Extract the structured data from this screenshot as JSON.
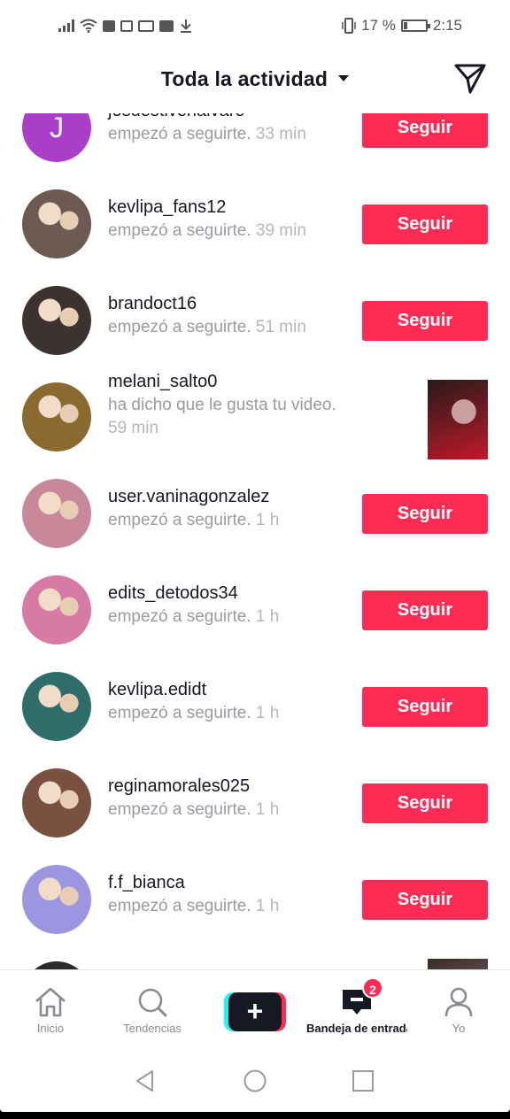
{
  "status_bar": {
    "battery_text": "17 %",
    "battery_level": 0.17,
    "time": "2:15"
  },
  "header": {
    "title": "Toda la actividad",
    "send_icon": "paper-plane-icon"
  },
  "items": [
    {
      "type": "follow",
      "username": "josuestivenalvare",
      "desc": "empezó a seguirte.",
      "time": "33 min",
      "button": "Seguir",
      "avatar_letter": "J",
      "avatar_color": "#a93fc8"
    },
    {
      "type": "follow",
      "username": "kevlipa_fans12",
      "desc": "empezó a seguirte.",
      "time": "39 min",
      "button": "Seguir",
      "avatar_color": "#6d5a52"
    },
    {
      "type": "follow",
      "username": "brandoct16",
      "desc": "empezó a seguirte.",
      "time": "51 min",
      "button": "Seguir",
      "avatar_color": "#3c3330"
    },
    {
      "type": "like",
      "username": "melani_salto0",
      "desc": "ha dicho que le gusta tu video.",
      "time": "59 min",
      "avatar_color": "#8a6a2e"
    },
    {
      "type": "follow",
      "username": "user.vaninagonzalez",
      "desc": "empezó a seguirte.",
      "time": "1 h",
      "button": "Seguir",
      "avatar_color": "#c9889a"
    },
    {
      "type": "follow",
      "username": "edits_detodos34",
      "desc": "empezó a seguirte.",
      "time": "1 h",
      "button": "Seguir",
      "avatar_color": "#d77aa6"
    },
    {
      "type": "follow",
      "username": "kevlipa.edidt",
      "desc": "empezó a seguirte.",
      "time": "1 h",
      "button": "Seguir",
      "avatar_color": "#2f6d6a"
    },
    {
      "type": "follow",
      "username": "reginamorales025",
      "desc": "empezó a seguirte.",
      "time": "1 h",
      "button": "Seguir",
      "avatar_color": "#7a5040"
    },
    {
      "type": "follow",
      "username": "f.f_bianca",
      "desc": "empezó a seguirte.",
      "time": "1 h",
      "button": "Seguir",
      "avatar_color": "#9c96e0"
    }
  ],
  "bottom_nav": {
    "home": "Inicio",
    "discover": "Tendencias",
    "inbox": "Bandeja de entrada",
    "inbox_badge": "2",
    "me": "Yo",
    "create": "+"
  },
  "colors": {
    "accent": "#fe2c55",
    "cyan": "#25f4ee",
    "text": "#161823",
    "muted": "#9a9ba0"
  }
}
